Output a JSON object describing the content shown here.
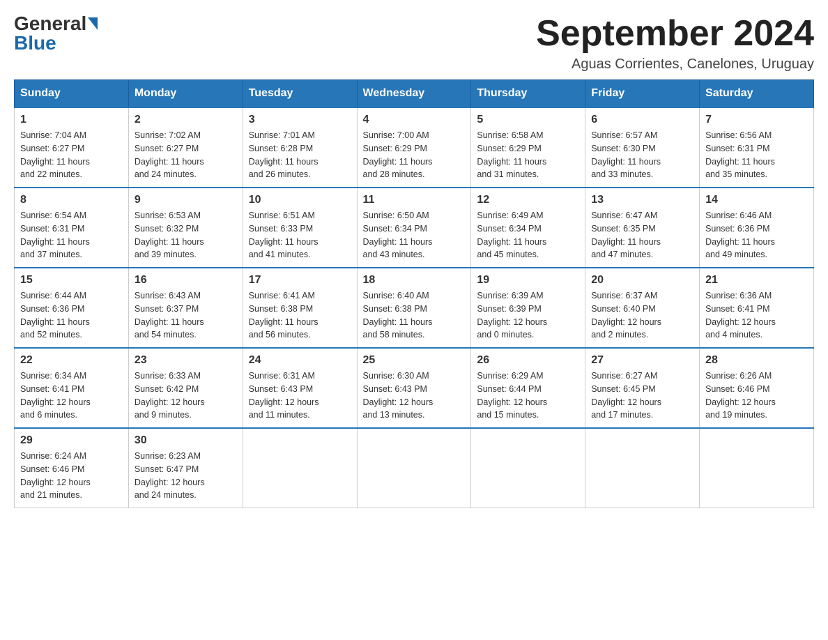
{
  "header": {
    "logo_general": "General",
    "logo_blue": "Blue",
    "month_title": "September 2024",
    "location": "Aguas Corrientes, Canelones, Uruguay"
  },
  "days_of_week": [
    "Sunday",
    "Monday",
    "Tuesday",
    "Wednesday",
    "Thursday",
    "Friday",
    "Saturday"
  ],
  "weeks": [
    [
      {
        "day": "1",
        "info": "Sunrise: 7:04 AM\nSunset: 6:27 PM\nDaylight: 11 hours\nand 22 minutes."
      },
      {
        "day": "2",
        "info": "Sunrise: 7:02 AM\nSunset: 6:27 PM\nDaylight: 11 hours\nand 24 minutes."
      },
      {
        "day": "3",
        "info": "Sunrise: 7:01 AM\nSunset: 6:28 PM\nDaylight: 11 hours\nand 26 minutes."
      },
      {
        "day": "4",
        "info": "Sunrise: 7:00 AM\nSunset: 6:29 PM\nDaylight: 11 hours\nand 28 minutes."
      },
      {
        "day": "5",
        "info": "Sunrise: 6:58 AM\nSunset: 6:29 PM\nDaylight: 11 hours\nand 31 minutes."
      },
      {
        "day": "6",
        "info": "Sunrise: 6:57 AM\nSunset: 6:30 PM\nDaylight: 11 hours\nand 33 minutes."
      },
      {
        "day": "7",
        "info": "Sunrise: 6:56 AM\nSunset: 6:31 PM\nDaylight: 11 hours\nand 35 minutes."
      }
    ],
    [
      {
        "day": "8",
        "info": "Sunrise: 6:54 AM\nSunset: 6:31 PM\nDaylight: 11 hours\nand 37 minutes."
      },
      {
        "day": "9",
        "info": "Sunrise: 6:53 AM\nSunset: 6:32 PM\nDaylight: 11 hours\nand 39 minutes."
      },
      {
        "day": "10",
        "info": "Sunrise: 6:51 AM\nSunset: 6:33 PM\nDaylight: 11 hours\nand 41 minutes."
      },
      {
        "day": "11",
        "info": "Sunrise: 6:50 AM\nSunset: 6:34 PM\nDaylight: 11 hours\nand 43 minutes."
      },
      {
        "day": "12",
        "info": "Sunrise: 6:49 AM\nSunset: 6:34 PM\nDaylight: 11 hours\nand 45 minutes."
      },
      {
        "day": "13",
        "info": "Sunrise: 6:47 AM\nSunset: 6:35 PM\nDaylight: 11 hours\nand 47 minutes."
      },
      {
        "day": "14",
        "info": "Sunrise: 6:46 AM\nSunset: 6:36 PM\nDaylight: 11 hours\nand 49 minutes."
      }
    ],
    [
      {
        "day": "15",
        "info": "Sunrise: 6:44 AM\nSunset: 6:36 PM\nDaylight: 11 hours\nand 52 minutes."
      },
      {
        "day": "16",
        "info": "Sunrise: 6:43 AM\nSunset: 6:37 PM\nDaylight: 11 hours\nand 54 minutes."
      },
      {
        "day": "17",
        "info": "Sunrise: 6:41 AM\nSunset: 6:38 PM\nDaylight: 11 hours\nand 56 minutes."
      },
      {
        "day": "18",
        "info": "Sunrise: 6:40 AM\nSunset: 6:38 PM\nDaylight: 11 hours\nand 58 minutes."
      },
      {
        "day": "19",
        "info": "Sunrise: 6:39 AM\nSunset: 6:39 PM\nDaylight: 12 hours\nand 0 minutes."
      },
      {
        "day": "20",
        "info": "Sunrise: 6:37 AM\nSunset: 6:40 PM\nDaylight: 12 hours\nand 2 minutes."
      },
      {
        "day": "21",
        "info": "Sunrise: 6:36 AM\nSunset: 6:41 PM\nDaylight: 12 hours\nand 4 minutes."
      }
    ],
    [
      {
        "day": "22",
        "info": "Sunrise: 6:34 AM\nSunset: 6:41 PM\nDaylight: 12 hours\nand 6 minutes."
      },
      {
        "day": "23",
        "info": "Sunrise: 6:33 AM\nSunset: 6:42 PM\nDaylight: 12 hours\nand 9 minutes."
      },
      {
        "day": "24",
        "info": "Sunrise: 6:31 AM\nSunset: 6:43 PM\nDaylight: 12 hours\nand 11 minutes."
      },
      {
        "day": "25",
        "info": "Sunrise: 6:30 AM\nSunset: 6:43 PM\nDaylight: 12 hours\nand 13 minutes."
      },
      {
        "day": "26",
        "info": "Sunrise: 6:29 AM\nSunset: 6:44 PM\nDaylight: 12 hours\nand 15 minutes."
      },
      {
        "day": "27",
        "info": "Sunrise: 6:27 AM\nSunset: 6:45 PM\nDaylight: 12 hours\nand 17 minutes."
      },
      {
        "day": "28",
        "info": "Sunrise: 6:26 AM\nSunset: 6:46 PM\nDaylight: 12 hours\nand 19 minutes."
      }
    ],
    [
      {
        "day": "29",
        "info": "Sunrise: 6:24 AM\nSunset: 6:46 PM\nDaylight: 12 hours\nand 21 minutes."
      },
      {
        "day": "30",
        "info": "Sunrise: 6:23 AM\nSunset: 6:47 PM\nDaylight: 12 hours\nand 24 minutes."
      },
      {
        "day": "",
        "info": ""
      },
      {
        "day": "",
        "info": ""
      },
      {
        "day": "",
        "info": ""
      },
      {
        "day": "",
        "info": ""
      },
      {
        "day": "",
        "info": ""
      }
    ]
  ]
}
